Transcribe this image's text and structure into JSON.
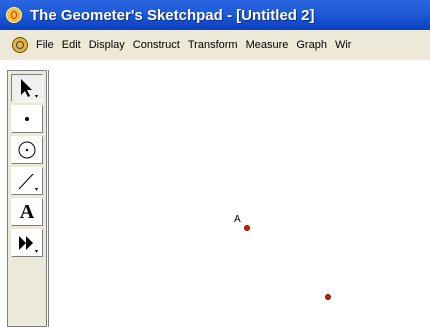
{
  "window": {
    "title": "The Geometer's Sketchpad - [Untitled 2]"
  },
  "menu": {
    "items": [
      "File",
      "Edit",
      "Display",
      "Construct",
      "Transform",
      "Measure",
      "Graph",
      "Wir"
    ]
  },
  "toolbox": {
    "tools": [
      {
        "name": "arrow-tool",
        "icon": "selection-arrow-icon",
        "active": true
      },
      {
        "name": "point-tool",
        "icon": "point-icon",
        "active": false
      },
      {
        "name": "compass-tool",
        "icon": "compass-circle-icon",
        "active": false
      },
      {
        "name": "straightedge-tool",
        "icon": "straightedge-line-icon",
        "active": false
      },
      {
        "name": "text-tool",
        "icon": "text-a-icon",
        "active": false,
        "glyph": "A"
      },
      {
        "name": "custom-tool",
        "icon": "custom-tool-arrows-icon",
        "active": false
      }
    ]
  },
  "sketch": {
    "points": [
      {
        "label": "A",
        "color": "#cc2200"
      },
      {
        "label": "",
        "color": "#cc2200"
      }
    ]
  }
}
